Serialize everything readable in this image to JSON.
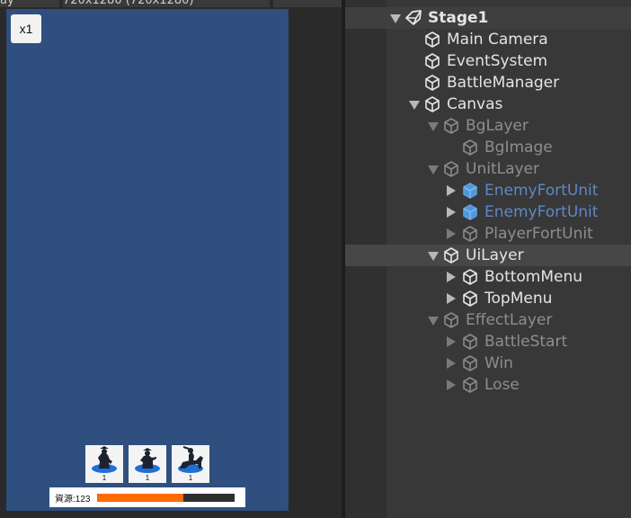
{
  "game_view": {
    "tab_left": "ay",
    "tab_main": "720x1280 (720x1280)",
    "zoom_label": "x1",
    "background_color": "#2f4f7f",
    "unit_cards": [
      {
        "icon": "archer-unit-icon",
        "count": "1"
      },
      {
        "icon": "crossbow-unit-icon",
        "count": "1"
      },
      {
        "icon": "cavalry-unit-icon",
        "count": "1"
      }
    ],
    "resource": {
      "label": "資源:123",
      "fill_fraction": 0.63,
      "fill_color": "#ff6a00"
    }
  },
  "hierarchy": {
    "items": [
      {
        "label": "Stage1",
        "style": "bold",
        "arrow": "down",
        "icon": "unity-scene-icon"
      },
      {
        "label": "Main Camera",
        "style": "normal",
        "arrow": "none",
        "icon": "gameobject-icon"
      },
      {
        "label": "EventSystem",
        "style": "normal",
        "arrow": "none",
        "icon": "gameobject-icon"
      },
      {
        "label": "BattleManager",
        "style": "normal",
        "arrow": "none",
        "icon": "gameobject-icon"
      },
      {
        "label": "Canvas",
        "style": "normal",
        "arrow": "down",
        "icon": "gameobject-icon"
      },
      {
        "label": "BgLayer",
        "style": "dim",
        "arrow": "down",
        "icon": "gameobject-icon"
      },
      {
        "label": "BgImage",
        "style": "dim",
        "arrow": "none",
        "icon": "gameobject-icon"
      },
      {
        "label": "UnitLayer",
        "style": "dim",
        "arrow": "down",
        "icon": "gameobject-icon"
      },
      {
        "label": "EnemyFortUnit",
        "style": "prefab",
        "arrow": "right",
        "icon": "prefab-icon"
      },
      {
        "label": "EnemyFortUnit",
        "style": "prefab",
        "arrow": "right",
        "icon": "prefab-icon"
      },
      {
        "label": "PlayerFortUnit",
        "style": "dim",
        "arrow": "right",
        "icon": "gameobject-icon"
      },
      {
        "label": "UiLayer",
        "style": "selected",
        "arrow": "down",
        "icon": "gameobject-icon"
      },
      {
        "label": "BottomMenu",
        "style": "normal",
        "arrow": "right",
        "icon": "gameobject-icon"
      },
      {
        "label": "TopMenu",
        "style": "normal",
        "arrow": "right",
        "icon": "gameobject-icon"
      },
      {
        "label": "EffectLayer",
        "style": "dim",
        "arrow": "down",
        "icon": "gameobject-icon"
      },
      {
        "label": "BattleStart",
        "style": "dim",
        "arrow": "right",
        "icon": "gameobject-icon"
      },
      {
        "label": "Win",
        "style": "dim",
        "arrow": "right",
        "icon": "gameobject-icon"
      },
      {
        "label": "Lose",
        "style": "dim",
        "arrow": "right",
        "icon": "gameobject-icon"
      }
    ]
  }
}
